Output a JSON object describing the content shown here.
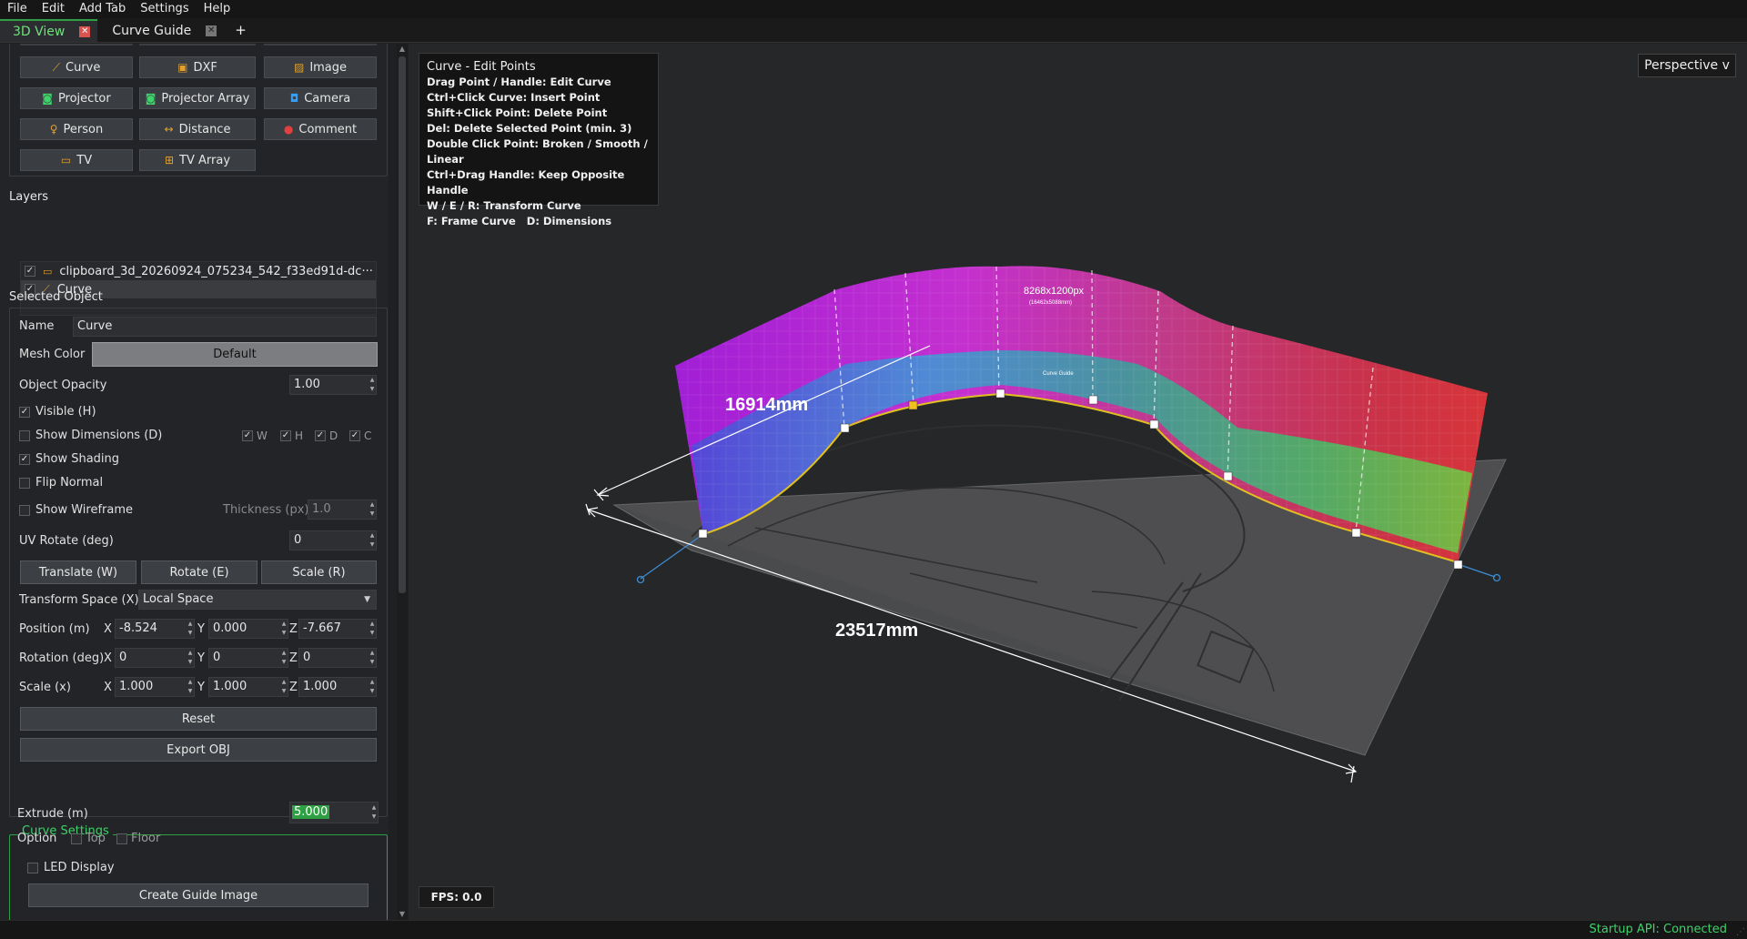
{
  "menu": [
    "File",
    "Edit",
    "Add Tab",
    "Settings",
    "Help"
  ],
  "tabs": [
    {
      "label": "3D View",
      "active": true,
      "close": "✕"
    },
    {
      "label": "Curve Guide",
      "active": false,
      "close": "✕"
    }
  ],
  "tab_add": "+",
  "add_buttons": [
    {
      "label": "Curve",
      "icon": "curve-icon",
      "glyph": "⟋"
    },
    {
      "label": "DXF",
      "icon": "dxf-icon",
      "glyph": "▣"
    },
    {
      "label": "Image",
      "icon": "image-icon",
      "glyph": "▨"
    },
    {
      "label": "Projector",
      "icon": "projector-icon",
      "glyph": "◙"
    },
    {
      "label": "Projector Array",
      "icon": "projector-array-icon",
      "glyph": "◙"
    },
    {
      "label": "Camera",
      "icon": "camera-icon",
      "glyph": "◘"
    },
    {
      "label": "Person",
      "icon": "person-icon",
      "glyph": "♀"
    },
    {
      "label": "Distance",
      "icon": "distance-icon",
      "glyph": "↔"
    },
    {
      "label": "Comment",
      "icon": "comment-icon",
      "glyph": "●"
    },
    {
      "label": "TV",
      "icon": "tv-icon",
      "glyph": "▭"
    },
    {
      "label": "TV Array",
      "icon": "tv-array-icon",
      "glyph": "⊞"
    }
  ],
  "layers": {
    "title": "Layers",
    "items": [
      {
        "label": "clipboard_3d_20260924_075234_542_f33ed91d-dc···",
        "checked": true,
        "icon": "image-layer-icon",
        "selected": false
      },
      {
        "label": "Curve",
        "checked": true,
        "icon": "curve-layer-icon",
        "selected": true
      }
    ]
  },
  "selected_object": {
    "title": "Selected Object",
    "name_label": "Name",
    "name_value": "Curve",
    "mesh_color_label": "Mesh Color",
    "mesh_color_button": "Default",
    "opacity_label": "Object Opacity",
    "opacity_value": "1.00",
    "visible_label": "Visible (H)",
    "show_dimensions_label": "Show Dimensions (D)",
    "dim_w": "W",
    "dim_h": "H",
    "dim_d": "D",
    "dim_c": "C",
    "show_shading_label": "Show Shading",
    "flip_normal_label": "Flip Normal",
    "show_wireframe_label": "Show Wireframe",
    "thickness_label": "Thickness (px)",
    "thickness_value": "1.0",
    "uv_rotate_label": "UV Rotate (deg)",
    "uv_rotate_value": "0",
    "translate_button": "Translate (W)",
    "rotate_button": "Rotate (E)",
    "scale_button": "Scale (R)",
    "transform_space_label": "Transform Space (X)",
    "transform_space_value": "Local Space",
    "position_label": "Position (m)",
    "position": {
      "x": "-8.524",
      "y": "0.000",
      "z": "-7.667"
    },
    "rotation_label": "Rotation (deg)",
    "rotation": {
      "x": "0",
      "y": "0",
      "z": "0"
    },
    "scale_label": "Scale (x)",
    "scale": {
      "x": "1.000",
      "y": "1.000",
      "z": "1.000"
    },
    "axis_x": "X",
    "axis_y": "Y",
    "axis_z": "Z",
    "reset_button": "Reset",
    "export_button": "Export OBJ"
  },
  "curve_settings": {
    "title": "Curve Settings",
    "extrude_label": "Extrude (m)",
    "extrude_value": "5.000",
    "option_label": "Option",
    "top_label": "Top",
    "floor_label": "Floor",
    "led_label": "LED Display",
    "create_button": "Create Guide Image"
  },
  "help_box": {
    "title": "Curve - Edit Points",
    "lines": [
      "Drag Point / Handle: Edit Curve",
      "Ctrl+Click Curve: Insert Point",
      "Shift+Click Point: Delete Point",
      "Del: Delete Selected Point (min. 3)",
      "Double Click Point: Broken / Smooth / Linear",
      "Ctrl+Drag Handle: Keep Opposite Handle",
      "W / E / R: Transform Curve",
      "F: Frame Curve   D: Dimensions"
    ]
  },
  "viewport": {
    "perspective_label": "Perspective v",
    "fps_label": "FPS: 0.0",
    "height_dimension": "16914mm",
    "width_dimension": "23517mm",
    "texture_label": "8268x1200px",
    "texture_sublabel": "(16462x5088mm)",
    "guide_label": "Curve Guide"
  },
  "status": "Startup API: Connected",
  "colors": {
    "accent": "#2ea043",
    "accent_text": "#3fd16a",
    "close_red": "#d9534f"
  }
}
